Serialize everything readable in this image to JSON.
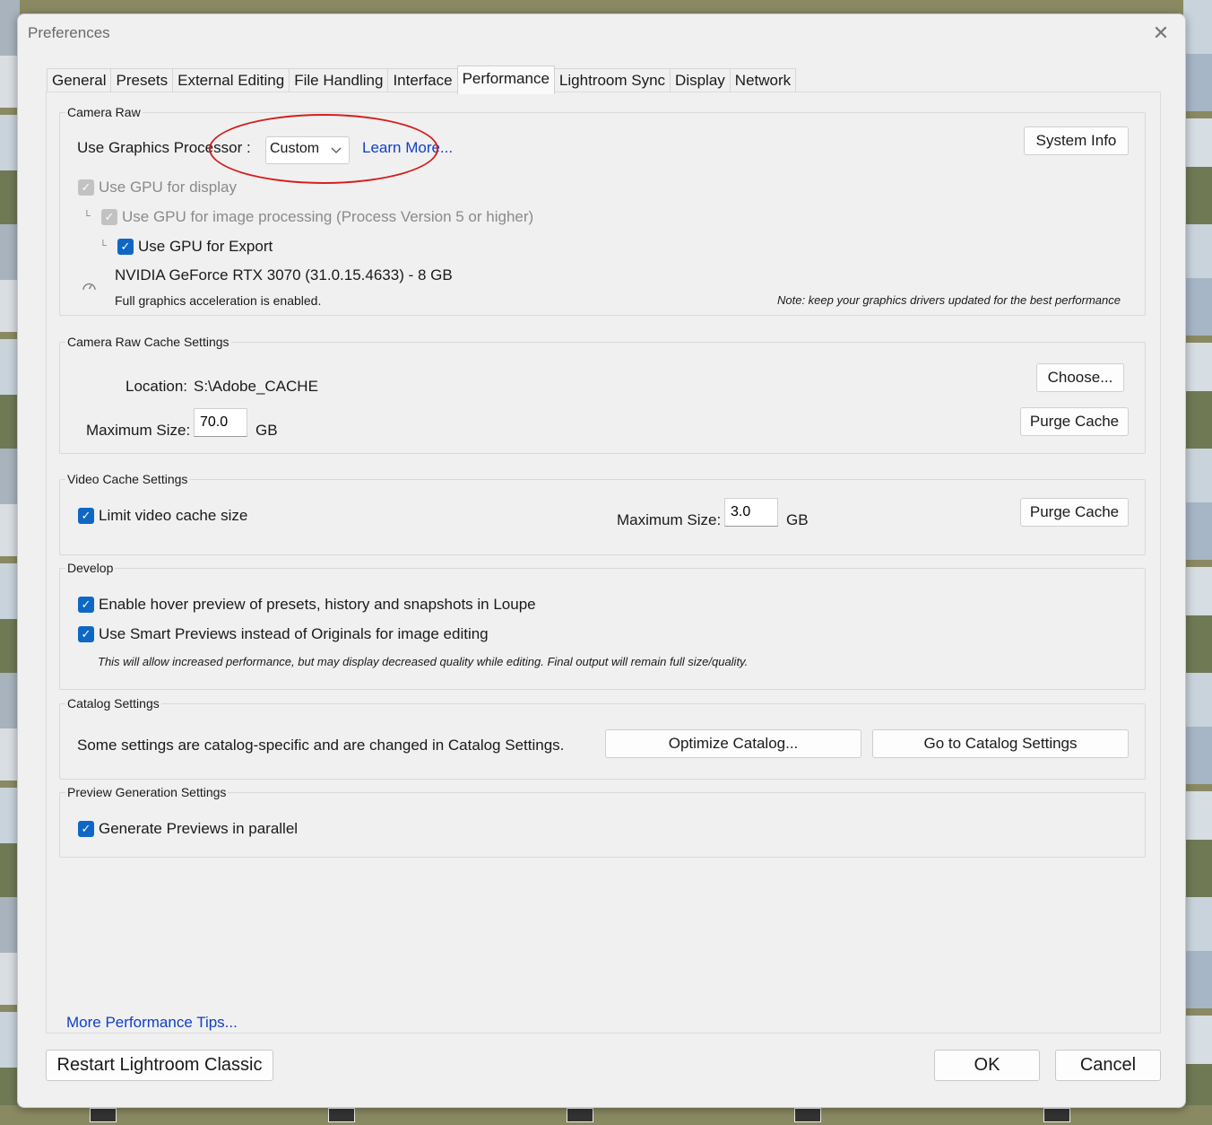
{
  "window": {
    "title": "Preferences",
    "close_glyph": "✕"
  },
  "tabs": [
    {
      "label": "General"
    },
    {
      "label": "Presets"
    },
    {
      "label": "External Editing"
    },
    {
      "label": "File Handling"
    },
    {
      "label": "Interface"
    },
    {
      "label": "Performance",
      "active": true
    },
    {
      "label": "Lightroom Sync"
    },
    {
      "label": "Display"
    },
    {
      "label": "Network"
    }
  ],
  "camera_raw": {
    "title": "Camera Raw",
    "gpu_label": "Use Graphics Processor :",
    "gpu_value": "Custom",
    "learn_more": "Learn More...",
    "system_info": "System Info",
    "gpu_display": "Use GPU for display",
    "gpu_processing": "Use GPU for image processing (Process Version 5 or higher)",
    "gpu_export": "Use GPU for Export",
    "gpu_name": "NVIDIA GeForce RTX 3070 (31.0.15.4633) - 8 GB",
    "accel_status": "Full graphics acceleration is enabled.",
    "driver_note": "Note: keep your graphics drivers updated for the best performance"
  },
  "cache": {
    "title": "Camera Raw Cache Settings",
    "location_label": "Location:",
    "location_value": "S:\\Adobe_CACHE",
    "choose": "Choose...",
    "max_label": "Maximum Size:",
    "max_value": "70.0",
    "unit": "GB",
    "purge": "Purge Cache"
  },
  "video_cache": {
    "title": "Video Cache Settings",
    "limit_label": "Limit video cache size",
    "max_label": "Maximum Size:",
    "max_value": "3.0",
    "unit": "GB",
    "purge": "Purge Cache"
  },
  "develop": {
    "title": "Develop",
    "hover_preview": "Enable hover preview of presets, history and snapshots in Loupe",
    "smart_previews": "Use Smart Previews instead of Originals for image editing",
    "smart_note": "This will allow increased performance, but may display decreased quality while editing. Final output will remain full size/quality."
  },
  "catalog": {
    "title": "Catalog Settings",
    "description": "Some settings are catalog-specific and are changed in Catalog Settings.",
    "optimize": "Optimize Catalog...",
    "goto": "Go to Catalog Settings"
  },
  "preview": {
    "title": "Preview Generation Settings",
    "parallel": "Generate Previews in parallel"
  },
  "footer": {
    "tips_link": "More Performance Tips...",
    "restart": "Restart Lightroom Classic",
    "ok": "OK",
    "cancel": "Cancel"
  },
  "icons": {
    "check": "✓",
    "tree": "└",
    "chevron": "chevron-down-icon",
    "gauge": "gauge-icon"
  },
  "colors": {
    "accent": "#0f67c5",
    "link": "#1140c8",
    "annotation": "#d32020"
  }
}
